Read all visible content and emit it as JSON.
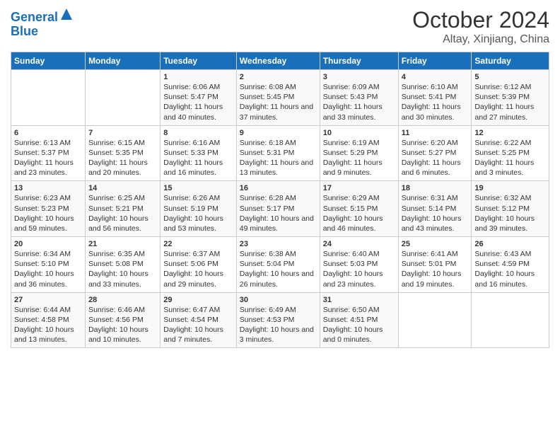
{
  "logo": {
    "line1": "General",
    "line2": "Blue"
  },
  "title": "October 2024",
  "subtitle": "Altay, Xinjiang, China",
  "days_of_week": [
    "Sunday",
    "Monday",
    "Tuesday",
    "Wednesday",
    "Thursday",
    "Friday",
    "Saturday"
  ],
  "weeks": [
    [
      {
        "day": "",
        "info": ""
      },
      {
        "day": "",
        "info": ""
      },
      {
        "day": "1",
        "info": "Sunrise: 6:06 AM\nSunset: 5:47 PM\nDaylight: 11 hours and 40 minutes."
      },
      {
        "day": "2",
        "info": "Sunrise: 6:08 AM\nSunset: 5:45 PM\nDaylight: 11 hours and 37 minutes."
      },
      {
        "day": "3",
        "info": "Sunrise: 6:09 AM\nSunset: 5:43 PM\nDaylight: 11 hours and 33 minutes."
      },
      {
        "day": "4",
        "info": "Sunrise: 6:10 AM\nSunset: 5:41 PM\nDaylight: 11 hours and 30 minutes."
      },
      {
        "day": "5",
        "info": "Sunrise: 6:12 AM\nSunset: 5:39 PM\nDaylight: 11 hours and 27 minutes."
      }
    ],
    [
      {
        "day": "6",
        "info": "Sunrise: 6:13 AM\nSunset: 5:37 PM\nDaylight: 11 hours and 23 minutes."
      },
      {
        "day": "7",
        "info": "Sunrise: 6:15 AM\nSunset: 5:35 PM\nDaylight: 11 hours and 20 minutes."
      },
      {
        "day": "8",
        "info": "Sunrise: 6:16 AM\nSunset: 5:33 PM\nDaylight: 11 hours and 16 minutes."
      },
      {
        "day": "9",
        "info": "Sunrise: 6:18 AM\nSunset: 5:31 PM\nDaylight: 11 hours and 13 minutes."
      },
      {
        "day": "10",
        "info": "Sunrise: 6:19 AM\nSunset: 5:29 PM\nDaylight: 11 hours and 9 minutes."
      },
      {
        "day": "11",
        "info": "Sunrise: 6:20 AM\nSunset: 5:27 PM\nDaylight: 11 hours and 6 minutes."
      },
      {
        "day": "12",
        "info": "Sunrise: 6:22 AM\nSunset: 5:25 PM\nDaylight: 11 hours and 3 minutes."
      }
    ],
    [
      {
        "day": "13",
        "info": "Sunrise: 6:23 AM\nSunset: 5:23 PM\nDaylight: 10 hours and 59 minutes."
      },
      {
        "day": "14",
        "info": "Sunrise: 6:25 AM\nSunset: 5:21 PM\nDaylight: 10 hours and 56 minutes."
      },
      {
        "day": "15",
        "info": "Sunrise: 6:26 AM\nSunset: 5:19 PM\nDaylight: 10 hours and 53 minutes."
      },
      {
        "day": "16",
        "info": "Sunrise: 6:28 AM\nSunset: 5:17 PM\nDaylight: 10 hours and 49 minutes."
      },
      {
        "day": "17",
        "info": "Sunrise: 6:29 AM\nSunset: 5:15 PM\nDaylight: 10 hours and 46 minutes."
      },
      {
        "day": "18",
        "info": "Sunrise: 6:31 AM\nSunset: 5:14 PM\nDaylight: 10 hours and 43 minutes."
      },
      {
        "day": "19",
        "info": "Sunrise: 6:32 AM\nSunset: 5:12 PM\nDaylight: 10 hours and 39 minutes."
      }
    ],
    [
      {
        "day": "20",
        "info": "Sunrise: 6:34 AM\nSunset: 5:10 PM\nDaylight: 10 hours and 36 minutes."
      },
      {
        "day": "21",
        "info": "Sunrise: 6:35 AM\nSunset: 5:08 PM\nDaylight: 10 hours and 33 minutes."
      },
      {
        "day": "22",
        "info": "Sunrise: 6:37 AM\nSunset: 5:06 PM\nDaylight: 10 hours and 29 minutes."
      },
      {
        "day": "23",
        "info": "Sunrise: 6:38 AM\nSunset: 5:04 PM\nDaylight: 10 hours and 26 minutes."
      },
      {
        "day": "24",
        "info": "Sunrise: 6:40 AM\nSunset: 5:03 PM\nDaylight: 10 hours and 23 minutes."
      },
      {
        "day": "25",
        "info": "Sunrise: 6:41 AM\nSunset: 5:01 PM\nDaylight: 10 hours and 19 minutes."
      },
      {
        "day": "26",
        "info": "Sunrise: 6:43 AM\nSunset: 4:59 PM\nDaylight: 10 hours and 16 minutes."
      }
    ],
    [
      {
        "day": "27",
        "info": "Sunrise: 6:44 AM\nSunset: 4:58 PM\nDaylight: 10 hours and 13 minutes."
      },
      {
        "day": "28",
        "info": "Sunrise: 6:46 AM\nSunset: 4:56 PM\nDaylight: 10 hours and 10 minutes."
      },
      {
        "day": "29",
        "info": "Sunrise: 6:47 AM\nSunset: 4:54 PM\nDaylight: 10 hours and 7 minutes."
      },
      {
        "day": "30",
        "info": "Sunrise: 6:49 AM\nSunset: 4:53 PM\nDaylight: 10 hours and 3 minutes."
      },
      {
        "day": "31",
        "info": "Sunrise: 6:50 AM\nSunset: 4:51 PM\nDaylight: 10 hours and 0 minutes."
      },
      {
        "day": "",
        "info": ""
      },
      {
        "day": "",
        "info": ""
      }
    ]
  ]
}
